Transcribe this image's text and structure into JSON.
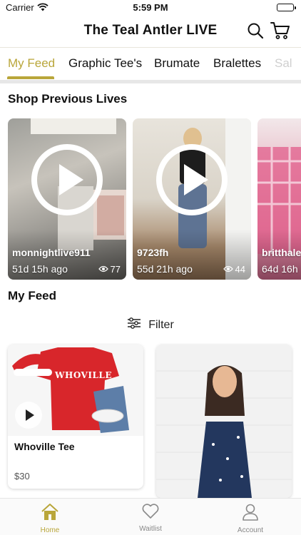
{
  "status_bar": {
    "carrier": "Carrier",
    "time": "5:59 PM"
  },
  "header": {
    "title": "The Teal Antler LIVE",
    "search_icon": "search-icon",
    "cart_icon": "cart-icon"
  },
  "tabs": [
    {
      "label": "My Feed",
      "active": true
    },
    {
      "label": "Graphic Tee's",
      "active": false
    },
    {
      "label": "Brumate",
      "active": false
    },
    {
      "label": "Bralettes",
      "active": false
    },
    {
      "label": "Sal",
      "active": false
    }
  ],
  "previous_lives": {
    "title": "Shop Previous Lives",
    "items": [
      {
        "user": "monnightlive911",
        "ago": "51d 15h ago",
        "views": "77"
      },
      {
        "user": "9723fh",
        "ago": "55d 21h ago",
        "views": "44"
      },
      {
        "user": "britthale",
        "ago": "64d 16h"
      }
    ]
  },
  "feed": {
    "title": "My Feed",
    "filter_label": "Filter",
    "products": [
      {
        "name": "Whoville Tee",
        "price": "$30",
        "shirt_text": "WHOVILLE"
      }
    ]
  },
  "bottom_nav": [
    {
      "label": "Home",
      "icon": "home-icon",
      "active": true
    },
    {
      "label": "Waitlist",
      "icon": "heart-icon",
      "active": false
    },
    {
      "label": "Account",
      "icon": "account-icon",
      "active": false
    }
  ],
  "colors": {
    "accent": "#b9a63a",
    "divider": "#e7e7e7"
  }
}
